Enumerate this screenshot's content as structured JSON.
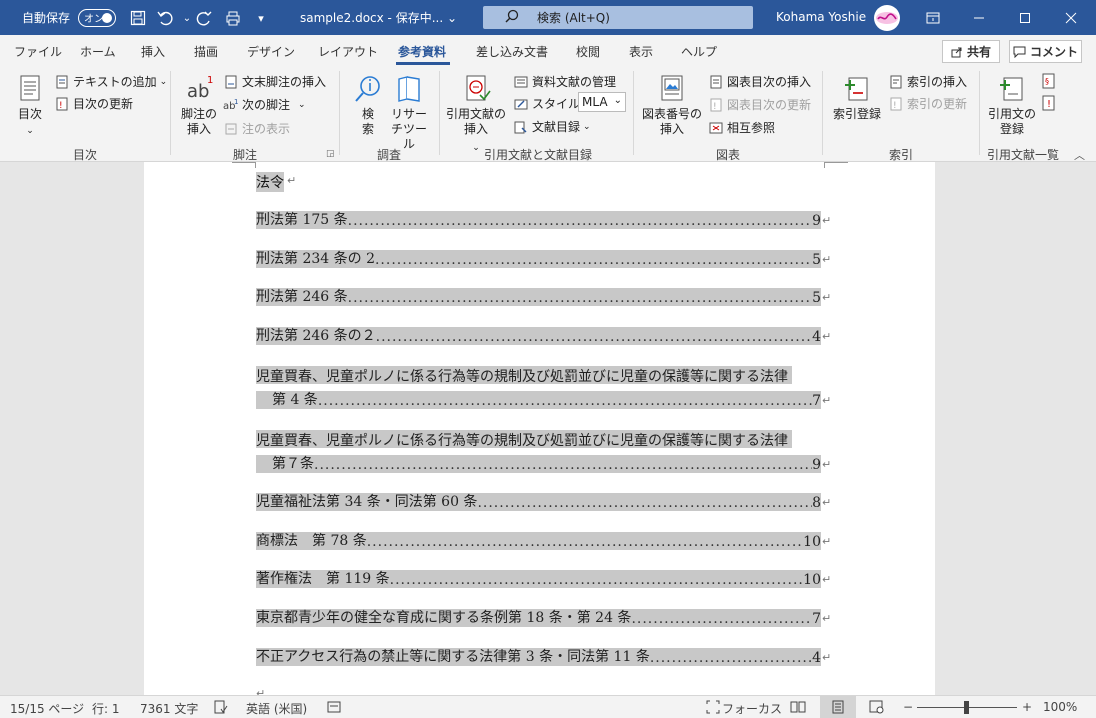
{
  "titlebar": {
    "autosave_label": "自動保存",
    "autosave_state": "オン",
    "doc_title": "sample2.docx - 保存中... ⌄",
    "search_placeholder": "検索 (Alt+Q)",
    "user_name": "Kohama Yoshie",
    "accent_color": "#2b579a"
  },
  "tabs": [
    {
      "label": "ファイル"
    },
    {
      "label": "ホーム"
    },
    {
      "label": "挿入"
    },
    {
      "label": "描画"
    },
    {
      "label": "デザイン"
    },
    {
      "label": "レイアウト"
    },
    {
      "label": "参考資料",
      "active": true
    },
    {
      "label": "差し込み文書"
    },
    {
      "label": "校閲"
    },
    {
      "label": "表示"
    },
    {
      "label": "ヘルプ"
    }
  ],
  "share_label": "共有",
  "comment_label": "コメント",
  "ribbon": {
    "toc_group": {
      "label": "目次",
      "toc_button": "目次",
      "add_text": "テキストの追加",
      "update_toc": "目次の更新"
    },
    "footnote_group": {
      "label": "脚注",
      "insert_footnote": "脚注の挿入",
      "insert_endnote": "文末脚注の挿入",
      "next_footnote": "次の脚注",
      "show_notes": "注の表示"
    },
    "research_group": {
      "label": "調査",
      "search": "検索",
      "researcher": "リサーチツール"
    },
    "citation_group": {
      "label": "引用文献と文献目録",
      "insert_citation": "引用文献の挿入",
      "manage_sources": "資料文献の管理",
      "style_label": "スタイル:",
      "style_value": "MLA",
      "bibliography": "文献目録"
    },
    "captions_group": {
      "label": "図表",
      "insert_caption": "図表番号の挿入",
      "insert_table_of_figures": "図表目次の挿入",
      "update_table": "図表目次の更新",
      "cross_reference": "相互参照"
    },
    "index_group": {
      "label": "索引",
      "mark_entry": "索引登録",
      "insert_index": "索引の挿入",
      "update_index": "索引の更新"
    },
    "toa_group": {
      "label": "引用文献一覧",
      "mark_citation": "引用文の登録"
    }
  },
  "document": {
    "heading": "法令",
    "entries": [
      {
        "text": "刑法第 175 条",
        "page": "9"
      },
      {
        "text": "刑法第 234 条の 2",
        "page": "5"
      },
      {
        "text": "刑法第 246 条",
        "page": "5"
      },
      {
        "text": "刑法第 246 条の２",
        "page": "4"
      },
      {
        "line1": "児童買春、児童ポルノに係る行為等の規制及び処罰並びに児童の保護等に関する法律",
        "text": "第 4 条",
        "page": "7"
      },
      {
        "line1": "児童買春、児童ポルノに係る行為等の規制及び処罰並びに児童の保護等に関する法律",
        "text": "第７条",
        "page": "9"
      },
      {
        "text": "児童福祉法第 34 条・同法第 60 条",
        "page": "8"
      },
      {
        "text": "商標法　第 78 条",
        "page": "10"
      },
      {
        "text": "著作権法　第 119 条",
        "page": "10"
      },
      {
        "text": "東京都青少年の健全な育成に関する条例第 18 条・第 24 条",
        "page": "7"
      },
      {
        "text": "不正アクセス行為の禁止等に関する法律第 3 条・同法第 11 条",
        "page": "4"
      }
    ]
  },
  "statusbar": {
    "page": "15/15 ページ",
    "line": "行: 1",
    "words": "7361 文字",
    "language": "英語 (米国)",
    "focus": "フォーカス",
    "zoom": "100%"
  }
}
